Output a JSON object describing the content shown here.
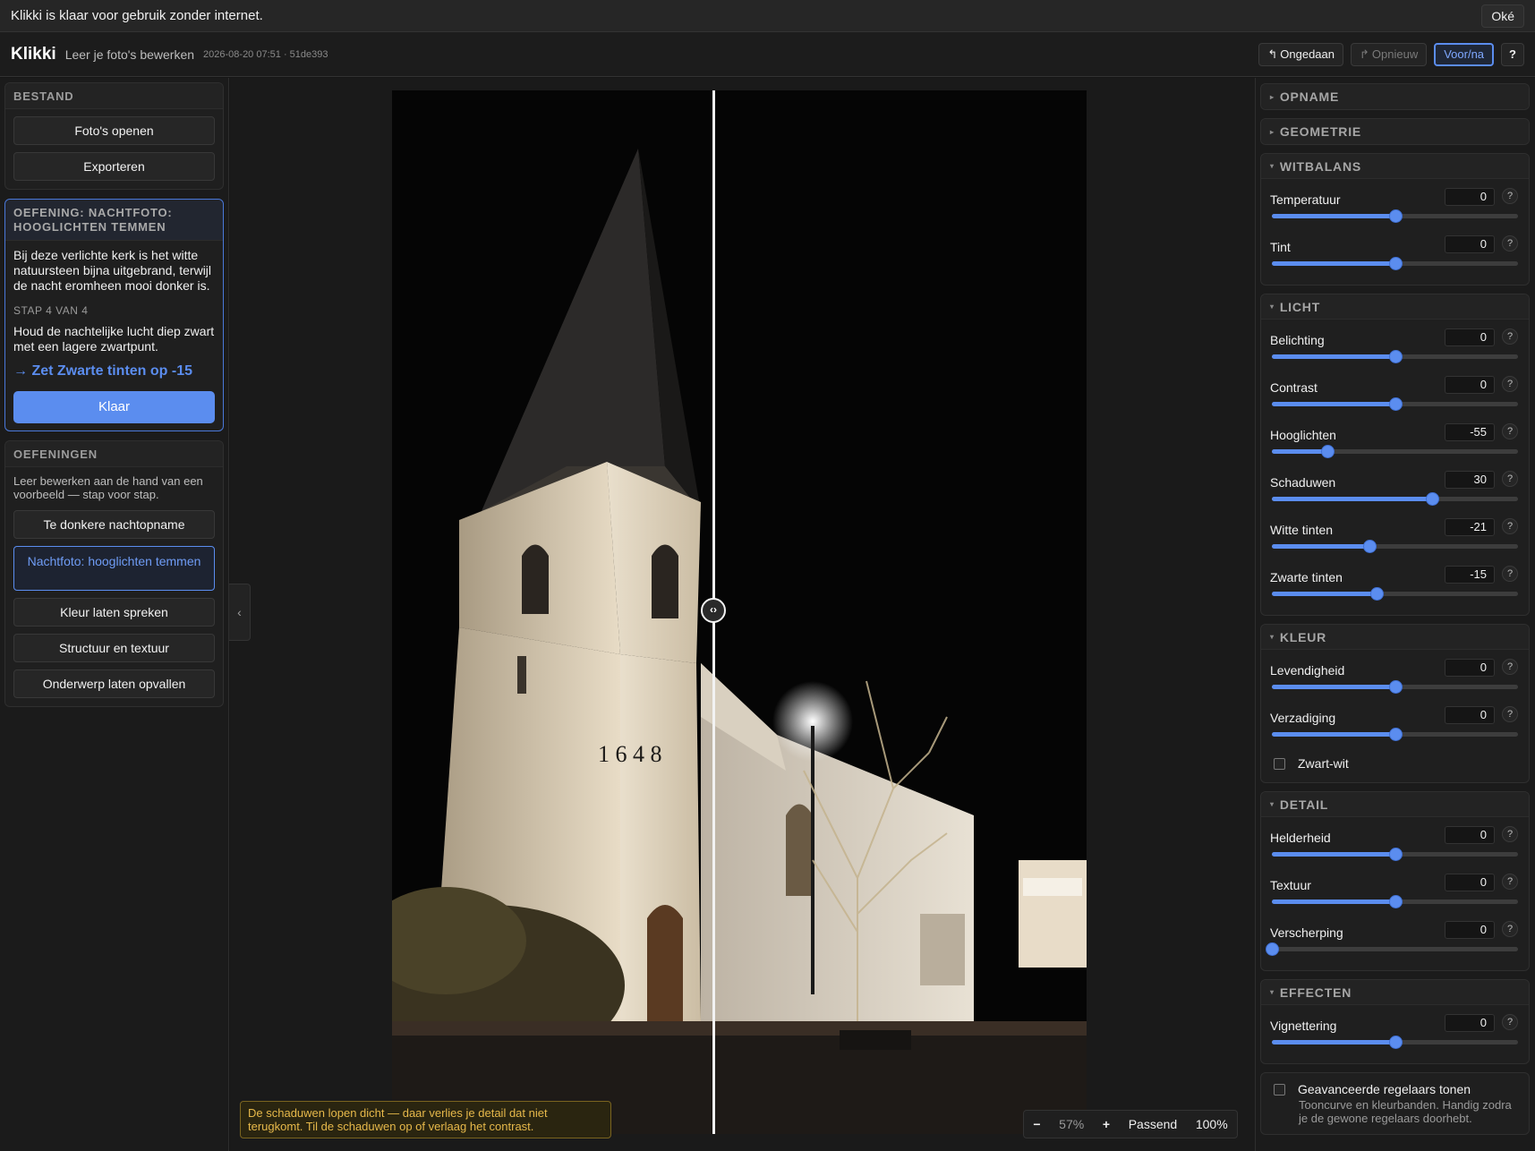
{
  "notification": {
    "text": "Klikki is klaar voor gebruik zonder internet.",
    "ok_label": "Oké"
  },
  "header": {
    "app_name": "Klikki",
    "subtitle": "Leer je foto's bewerken",
    "meta": "2026-08-20 07:51 · 51de393",
    "undo_label": "Ongedaan",
    "redo_label": "Opnieuw",
    "before_after_label": "Voor/na",
    "help_label": "?",
    "undo_icon": "undo-arrow",
    "redo_icon": "redo-arrow"
  },
  "left": {
    "bestand": {
      "title": "BESTAND",
      "open_label": "Foto's openen",
      "export_label": "Exporteren"
    },
    "exercise": {
      "title": "OEFENING: NACHTFOTO: HOOGLICHTEN TEMMEN",
      "description": "Bij deze verlichte kerk is het witte natuursteen bijna uitgebrand, terwijl de nacht eromheen mooi donker is.",
      "step": "STAP 4 VAN 4",
      "instruction": "Houd de nachtelijke lucht diep zwart met een lagere zwartpunt.",
      "target": "→ Zet Zwarte tinten op -15",
      "done_label": "Klaar"
    },
    "exercises": {
      "title": "OEFENINGEN",
      "intro": "Leer bewerken aan de hand van een voorbeeld — stap voor stap.",
      "items": [
        {
          "label": "Te donkere nachtopname",
          "selected": false
        },
        {
          "label": "Nachtfoto: hooglichten temmen",
          "selected": true
        },
        {
          "label": "Kleur laten spreken",
          "selected": false
        },
        {
          "label": "Structuur en textuur",
          "selected": false
        },
        {
          "label": "Onderwerp laten opvallen",
          "selected": false
        }
      ]
    }
  },
  "canvas": {
    "warning": "De schaduwen lopen dicht — daar verlies je detail dat niet terugkomt. Til de schaduwen op of verlaag het contrast.",
    "zoom": {
      "minus": "−",
      "percent": "57%",
      "plus": "+",
      "fit": "Passend",
      "full": "100%"
    },
    "collapse_icon": "chevron-left",
    "split_handle_icon": "left-right-arrows",
    "photo_text": "1 6 4 8"
  },
  "right": {
    "collapsed_sections": [
      "OPNAME",
      "GEOMETRIE"
    ],
    "witbalans": {
      "title": "WITBALANS",
      "controls": [
        {
          "label": "Temperatuur",
          "value": "0",
          "fraction": 0.5
        },
        {
          "label": "Tint",
          "value": "0",
          "fraction": 0.5
        }
      ]
    },
    "licht": {
      "title": "LICHT",
      "controls": [
        {
          "label": "Belichting",
          "value": "0",
          "fraction": 0.5
        },
        {
          "label": "Contrast",
          "value": "0",
          "fraction": 0.5
        },
        {
          "label": "Hooglichten",
          "value": "-55",
          "fraction": 0.225
        },
        {
          "label": "Schaduwen",
          "value": "30",
          "fraction": 0.65
        },
        {
          "label": "Witte tinten",
          "value": "-21",
          "fraction": 0.395
        },
        {
          "label": "Zwarte tinten",
          "value": "-15",
          "fraction": 0.425
        }
      ]
    },
    "kleur": {
      "title": "KLEUR",
      "controls": [
        {
          "label": "Levendigheid",
          "value": "0",
          "fraction": 0.5
        },
        {
          "label": "Verzadiging",
          "value": "0",
          "fraction": 0.5
        }
      ],
      "bw_label": "Zwart-wit"
    },
    "detail": {
      "title": "DETAIL",
      "controls": [
        {
          "label": "Helderheid",
          "value": "0",
          "fraction": 0.5
        },
        {
          "label": "Textuur",
          "value": "0",
          "fraction": 0.5
        },
        {
          "label": "Verscherping",
          "value": "0",
          "fraction": 0.0
        }
      ]
    },
    "effecten": {
      "title": "EFFECTEN",
      "controls": [
        {
          "label": "Vignettering",
          "value": "0",
          "fraction": 0.5
        }
      ]
    },
    "advanced": {
      "label": "Geavanceerde regelaars tonen",
      "description": "Tooncurve en kleurbanden. Handig zodra je de gewone regelaars doorhebt."
    },
    "help_label": "?"
  },
  "colors": {
    "accent": "#5b8def",
    "warning": "#e6b84a",
    "background": "#161616"
  }
}
